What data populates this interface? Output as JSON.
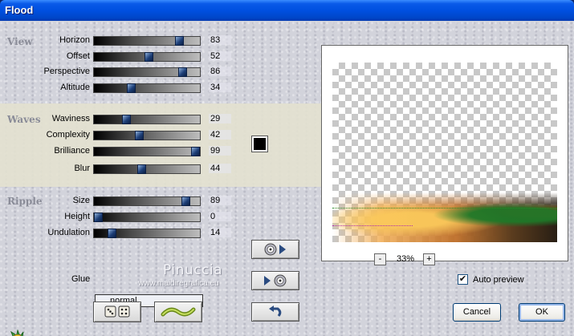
{
  "window": {
    "title": "Flood"
  },
  "sections": {
    "view": "View",
    "waves": "Waves",
    "ripple": "Ripple"
  },
  "sliders": {
    "horizon": {
      "label": "Horizon",
      "value": "83",
      "max": 100
    },
    "offset": {
      "label": "Offset",
      "value": "52",
      "max": 100
    },
    "perspective": {
      "label": "Perspective",
      "value": "86",
      "max": 100
    },
    "altitude": {
      "label": "Altitude",
      "value": "34",
      "max": 100
    },
    "waviness": {
      "label": "Waviness",
      "value": "29",
      "max": 100
    },
    "complexity": {
      "label": "Complexity",
      "value": "42",
      "max": 100
    },
    "brilliance": {
      "label": "Brilliance",
      "value": "99",
      "max": 100
    },
    "blur": {
      "label": "Blur",
      "value": "44",
      "max": 100
    },
    "size": {
      "label": "Size",
      "value": "89",
      "max": 100
    },
    "height": {
      "label": "Height",
      "value": "0",
      "max": 100
    },
    "undulation": {
      "label": "Undulation",
      "value": "14",
      "max": 100
    }
  },
  "waves_color": "#000000",
  "glue": {
    "label": "Glue",
    "value": "normal"
  },
  "watermark": {
    "name": "Pinuccia",
    "site": "www.maidiregrafica.eu"
  },
  "preview": {
    "zoom_out": "-",
    "zoom_level": "33%",
    "zoom_in": "+",
    "auto_preview_label": "Auto preview",
    "auto_preview_checked": true,
    "checkmark": "✔"
  },
  "buttons": {
    "cancel": "Cancel",
    "ok": "OK"
  },
  "icons": {
    "app": "plugin-logo-icon",
    "randomize": "dice-icon",
    "presets": "wave-icon",
    "load": "disc-play-icon",
    "save": "play-disc-icon",
    "reset": "undo-arrow-icon"
  },
  "colors": {
    "titlebar": "#0050e0",
    "waves_band": "#e3e1cf"
  }
}
